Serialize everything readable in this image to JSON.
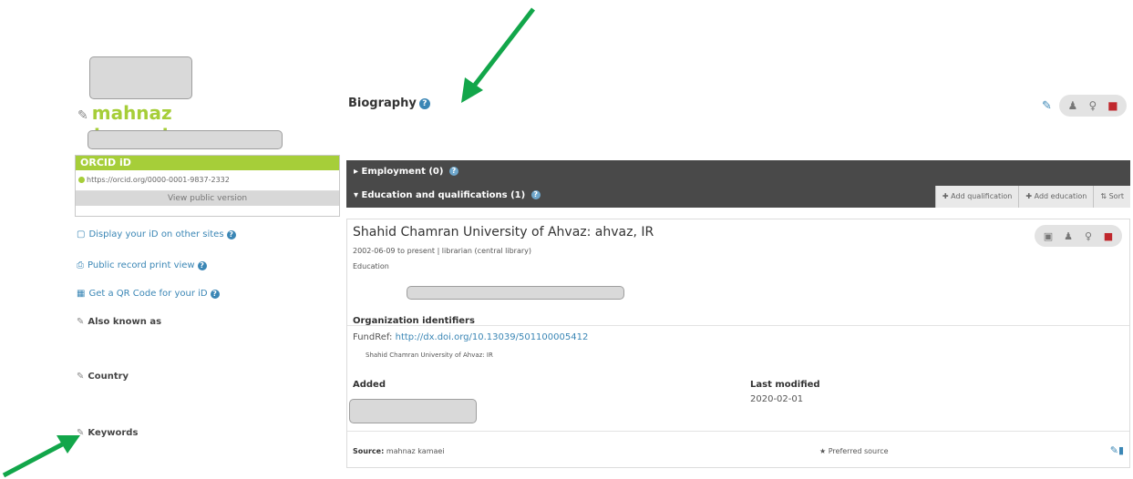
{
  "profile": {
    "name_line1": "mahnaz",
    "name_line2": "kamaei",
    "orcid_header": "ORCID iD",
    "orcid_url": "https://orcid.org/0000-0001-9837-2332",
    "view_public": "View public version"
  },
  "sidebar": {
    "display_id": "Display your iD on other sites",
    "print_view": "Public record print view",
    "qr_code": "Get a QR Code for your iD",
    "also_known_as": "Also known as",
    "country": "Country",
    "keywords": "Keywords"
  },
  "biography": {
    "title": "Biography"
  },
  "sections": {
    "employment": "Employment (0)",
    "education": "Education and qualifications (1)",
    "add_qualification": "Add qualification",
    "add_education": "Add education",
    "sort": "Sort"
  },
  "card": {
    "title": "Shahid Chamran University of Ahvaz: ahvaz, IR",
    "dates": "2002-06-09 to present | librarian (central library)",
    "type": "Education",
    "org_ids_label": "Organization identifiers",
    "fundref_label": "FundRef:",
    "fundref_link": "http://dx.doi.org/10.13039/501100005412",
    "fundref_inst": "Shahid Chamran University of Ahvaz: IR",
    "added_label": "Added",
    "modified_label": "Last modified",
    "modified_value": "2020-02-01",
    "source_label": "Source:",
    "source_value": "mahnaz kamaei",
    "preferred": "Preferred source"
  },
  "colors": {
    "orcid_green": "#a6ce39",
    "arrow_green": "#12a64a",
    "link_blue": "#3a86b5",
    "dark_bar": "#494949",
    "lock_red": "#c0272d"
  }
}
